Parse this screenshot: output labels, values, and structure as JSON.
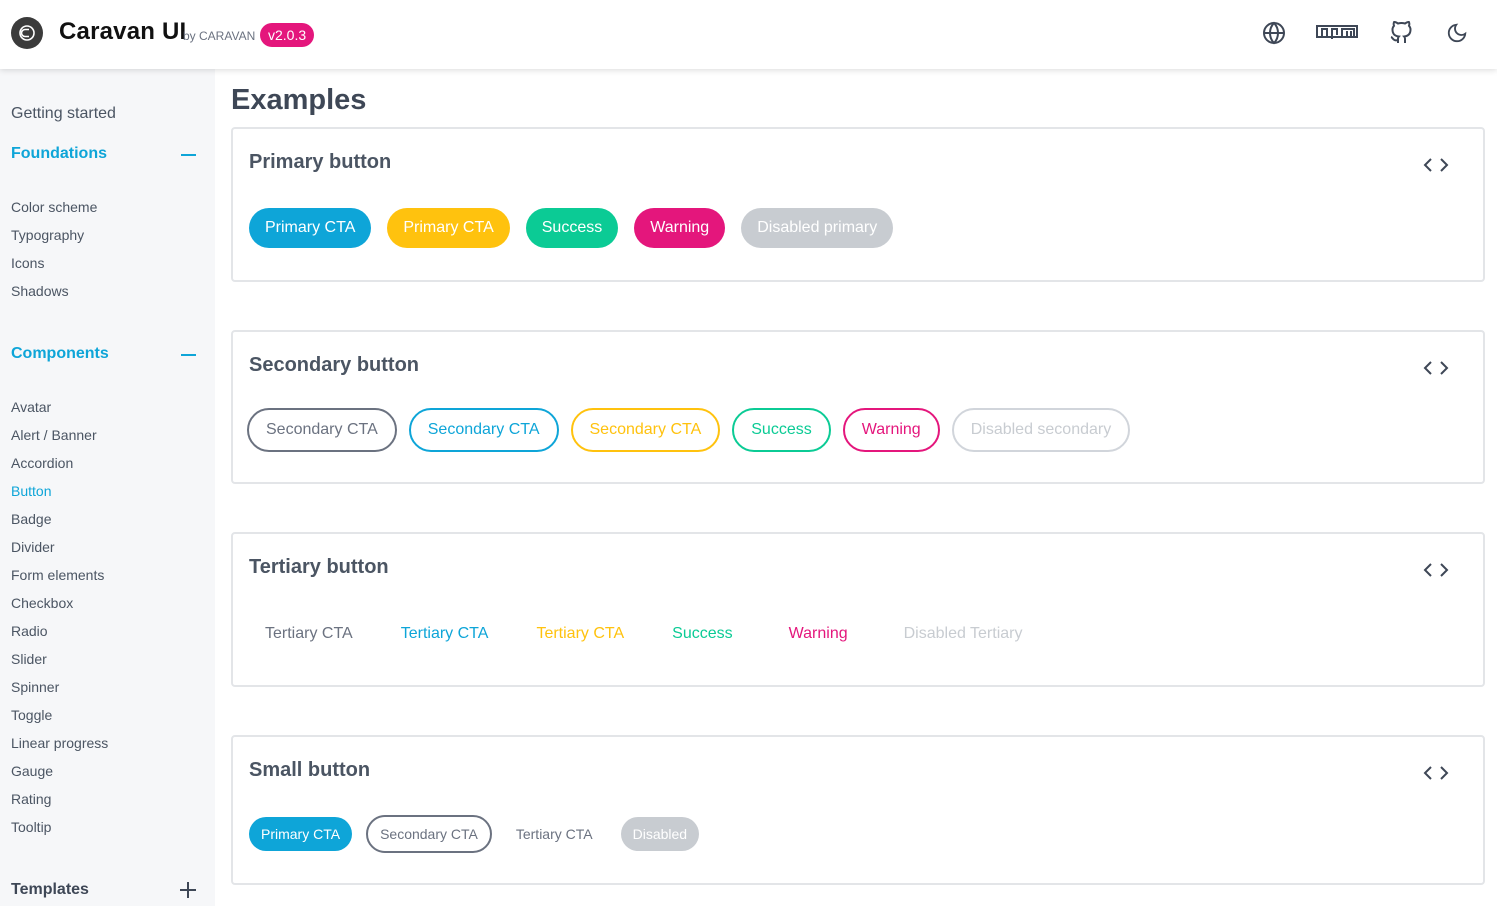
{
  "header": {
    "brand": "Caravan UI",
    "byline": "by CARAVAN",
    "version": "v2.0.3",
    "icons": [
      "globe-icon",
      "npm-icon",
      "github-icon",
      "moon-icon"
    ]
  },
  "sidebar": {
    "getting_started": "Getting started",
    "foundations": {
      "label": "Foundations",
      "items": [
        "Color scheme",
        "Typography",
        "Icons",
        "Shadows"
      ]
    },
    "components": {
      "label": "Components",
      "items": [
        "Avatar",
        "Alert / Banner",
        "Accordion",
        "Button",
        "Badge",
        "Divider",
        "Form elements",
        "Checkbox",
        "Radio",
        "Slider",
        "Spinner",
        "Toggle",
        "Linear progress",
        "Gauge",
        "Rating",
        "Tooltip"
      ],
      "active": "Button"
    },
    "templates": {
      "label": "Templates"
    }
  },
  "main": {
    "title": "Examples",
    "cards": [
      {
        "title": "Primary button",
        "buttons": [
          "Primary CTA",
          "Primary CTA",
          "Success",
          "Warning",
          "Disabled primary"
        ]
      },
      {
        "title": "Secondary button",
        "buttons": [
          "Secondary CTA",
          "Secondary CTA",
          "Secondary CTA",
          "Success",
          "Warning",
          "Disabled secondary"
        ]
      },
      {
        "title": "Tertiary button",
        "buttons": [
          "Tertiary CTA",
          "Tertiary CTA",
          "Tertiary CTA",
          "Success",
          "Warning",
          "Disabled Tertiary"
        ]
      },
      {
        "title": "Small button",
        "buttons": [
          "Primary CTA",
          "Secondary CTA",
          "Tertiary CTA",
          "Disabled"
        ]
      }
    ]
  },
  "colors": {
    "accent": "#0ea5d8",
    "yellow": "#ffc20e",
    "success": "#0bcb95",
    "warning": "#e4167c",
    "disabled": "#c8ccd1",
    "neutral": "#6b7280"
  }
}
